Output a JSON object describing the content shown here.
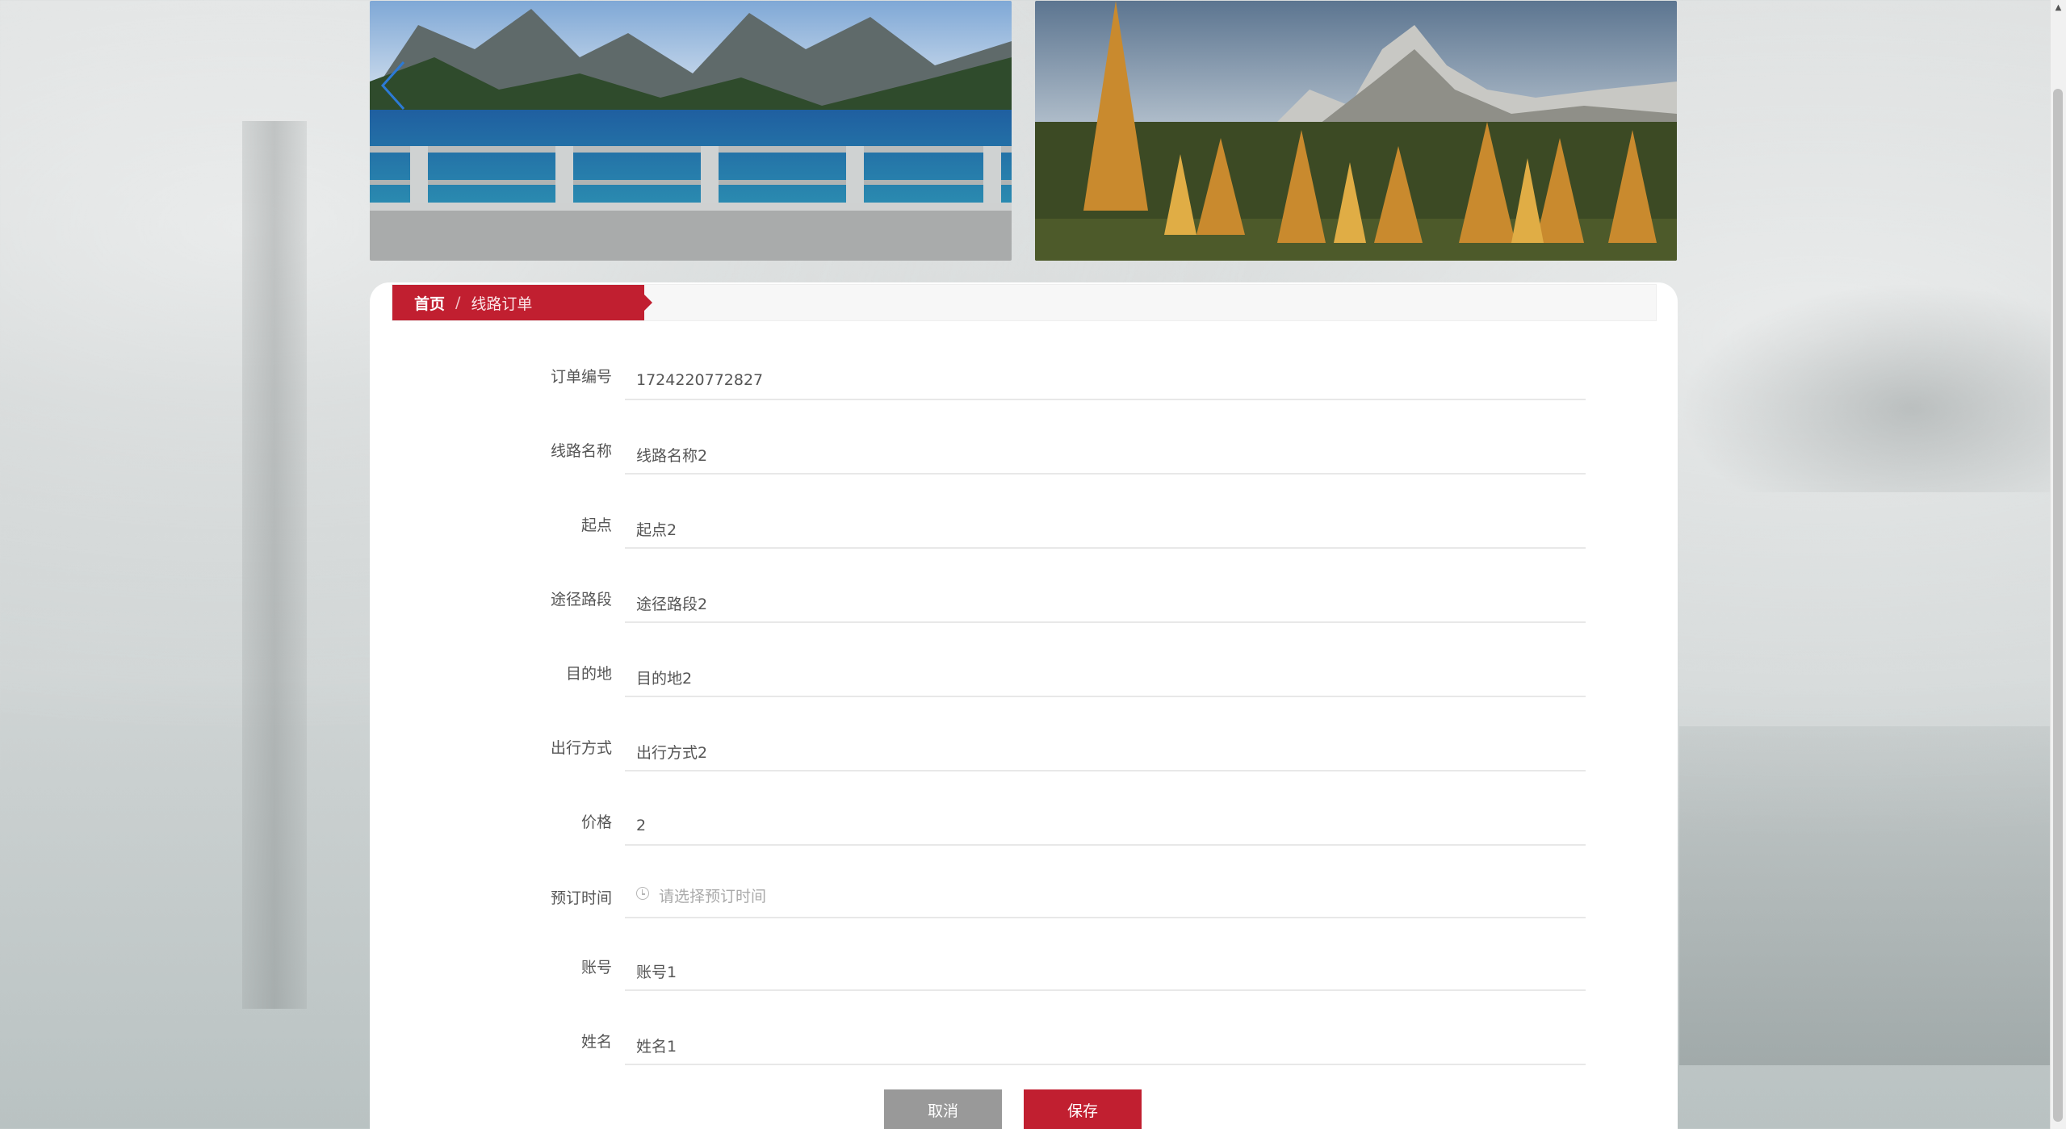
{
  "banner": {
    "slides": [
      {
        "icon": "lake-bridge-landscape"
      },
      {
        "icon": "autumn-mountain-landscape"
      }
    ],
    "prev_icon": "chevron-left-icon"
  },
  "breadcrumb": {
    "home": "首页",
    "separator": "/",
    "current": "线路订单"
  },
  "form": {
    "order_no": {
      "label": "订单编号",
      "value": "1724220772827"
    },
    "route_name": {
      "label": "线路名称",
      "value": "线路名称2"
    },
    "start": {
      "label": "起点",
      "value": "起点2"
    },
    "via": {
      "label": "途径路段",
      "value": "途径路段2"
    },
    "destination": {
      "label": "目的地",
      "value": "目的地2"
    },
    "travel_mode": {
      "label": "出行方式",
      "value": "出行方式2"
    },
    "price": {
      "label": "价格",
      "value": "2"
    },
    "booking_time": {
      "label": "预订时间",
      "value": "",
      "placeholder": "请选择预订时间"
    },
    "account": {
      "label": "账号",
      "value": "账号1"
    },
    "name": {
      "label": "姓名",
      "value": "姓名1"
    }
  },
  "actions": {
    "cancel": "取消",
    "save": "保存"
  },
  "colors": {
    "accent": "#c11f30",
    "cancel": "#999999"
  }
}
